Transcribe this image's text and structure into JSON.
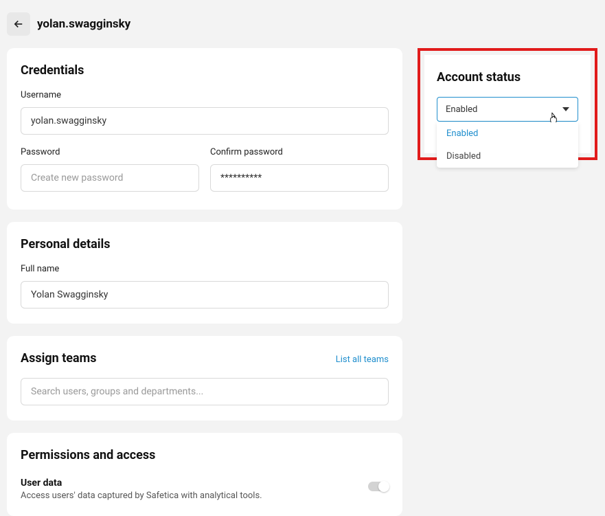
{
  "header": {
    "title": "yolan.swagginsky"
  },
  "credentials": {
    "title": "Credentials",
    "username_label": "Username",
    "username_value": "yolan.swagginsky",
    "password_label": "Password",
    "password_placeholder": "Create new password",
    "confirm_label": "Confirm password",
    "confirm_value": "**********"
  },
  "personal": {
    "title": "Personal details",
    "fullname_label": "Full name",
    "fullname_value": "Yolan Swagginsky"
  },
  "teams": {
    "title": "Assign teams",
    "list_all": "List all teams",
    "search_placeholder": "Search users, groups and departments..."
  },
  "permissions": {
    "title": "Permissions and access",
    "userdata_label": "User data",
    "userdata_desc": "Access users' data captured by Safetica with analytical tools."
  },
  "status": {
    "title": "Account status",
    "selected": "Enabled",
    "options": [
      "Enabled",
      "Disabled"
    ]
  }
}
